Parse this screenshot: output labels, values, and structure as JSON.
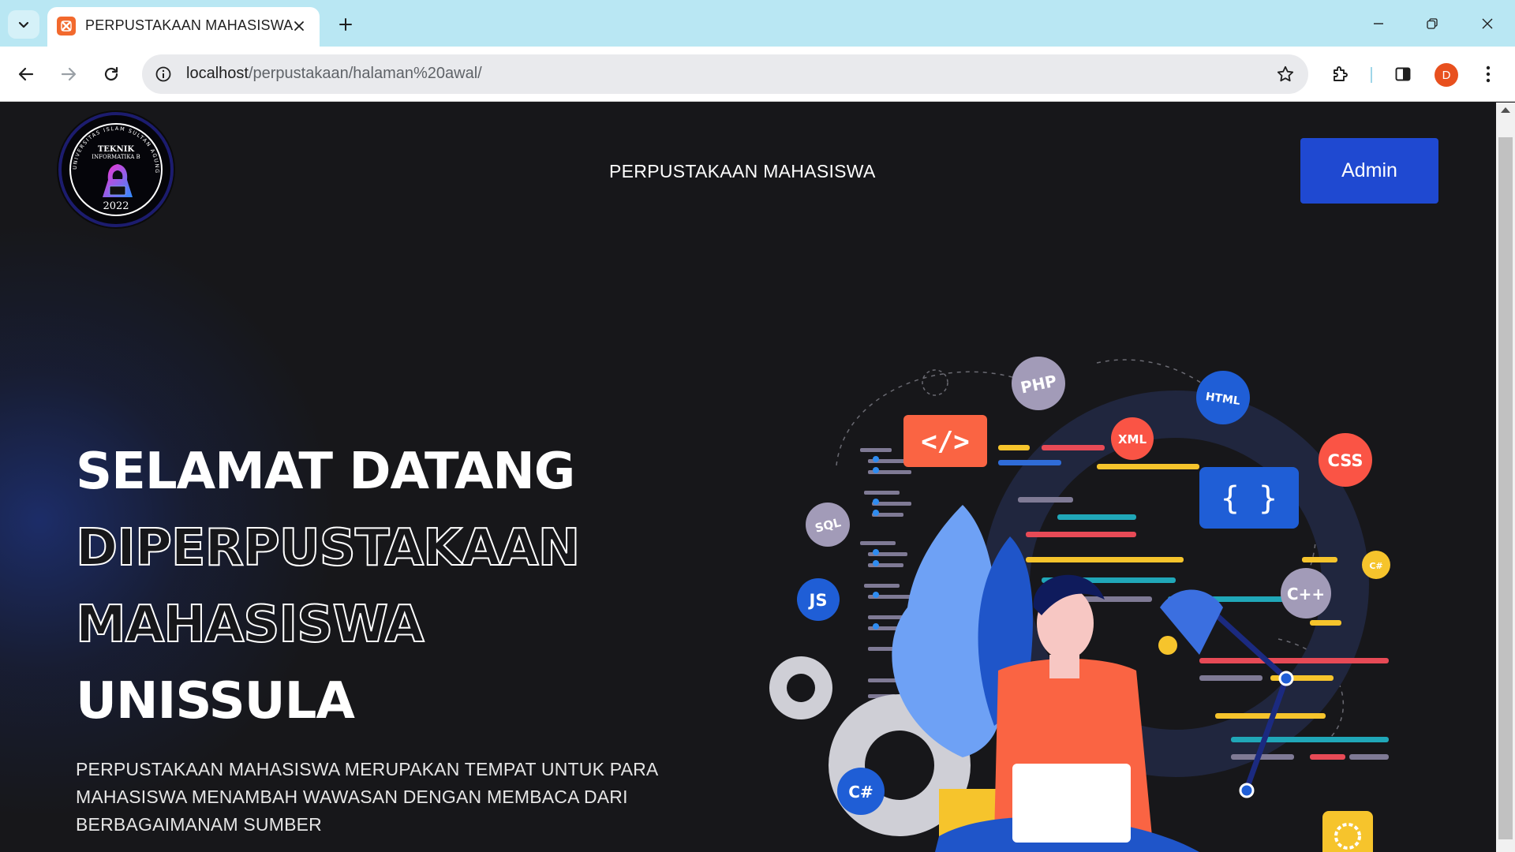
{
  "browser": {
    "tab_title": "PERPUSTAKAAN MAHASISWA",
    "url_host": "localhost",
    "url_path": "/perpustakaan/halaman%20awal/",
    "profile_initial": "D",
    "accent_color": "#b9e7f3"
  },
  "header": {
    "logo": {
      "line1": "TEKNIK",
      "line2": "INFORMATIKA B",
      "year": "2022",
      "ring_text": "UNIVERSITAS ISLAM SULTAN AGUNG"
    },
    "site_title": "PERPUSTAKAAN MAHASISWA",
    "admin_label": "Admin",
    "admin_color": "#1f49d1"
  },
  "hero": {
    "line1": "SELAMAT DATANG",
    "line2": "DIPERPUSTAKAAN",
    "line3": "MAHASISWA",
    "line4": "UNISSULA",
    "description": "PERPUSTAKAAN MAHASISWA MERUPAKAN TEMPAT UNTUK PARA MAHASISWA MENAMBAH WAWASAN DENGAN MEMBACA DARI BERBAGAIMANAM SUMBER"
  },
  "illustration": {
    "badges": {
      "php": "PHP",
      "html": "HTML",
      "xml": "XML",
      "css": "CSS",
      "sql": "SQL",
      "js": "JS",
      "csharp": "C#",
      "cpp": "C++",
      "csharp_small": "C#",
      "code_tag": "</>",
      "braces": "{  }"
    }
  }
}
